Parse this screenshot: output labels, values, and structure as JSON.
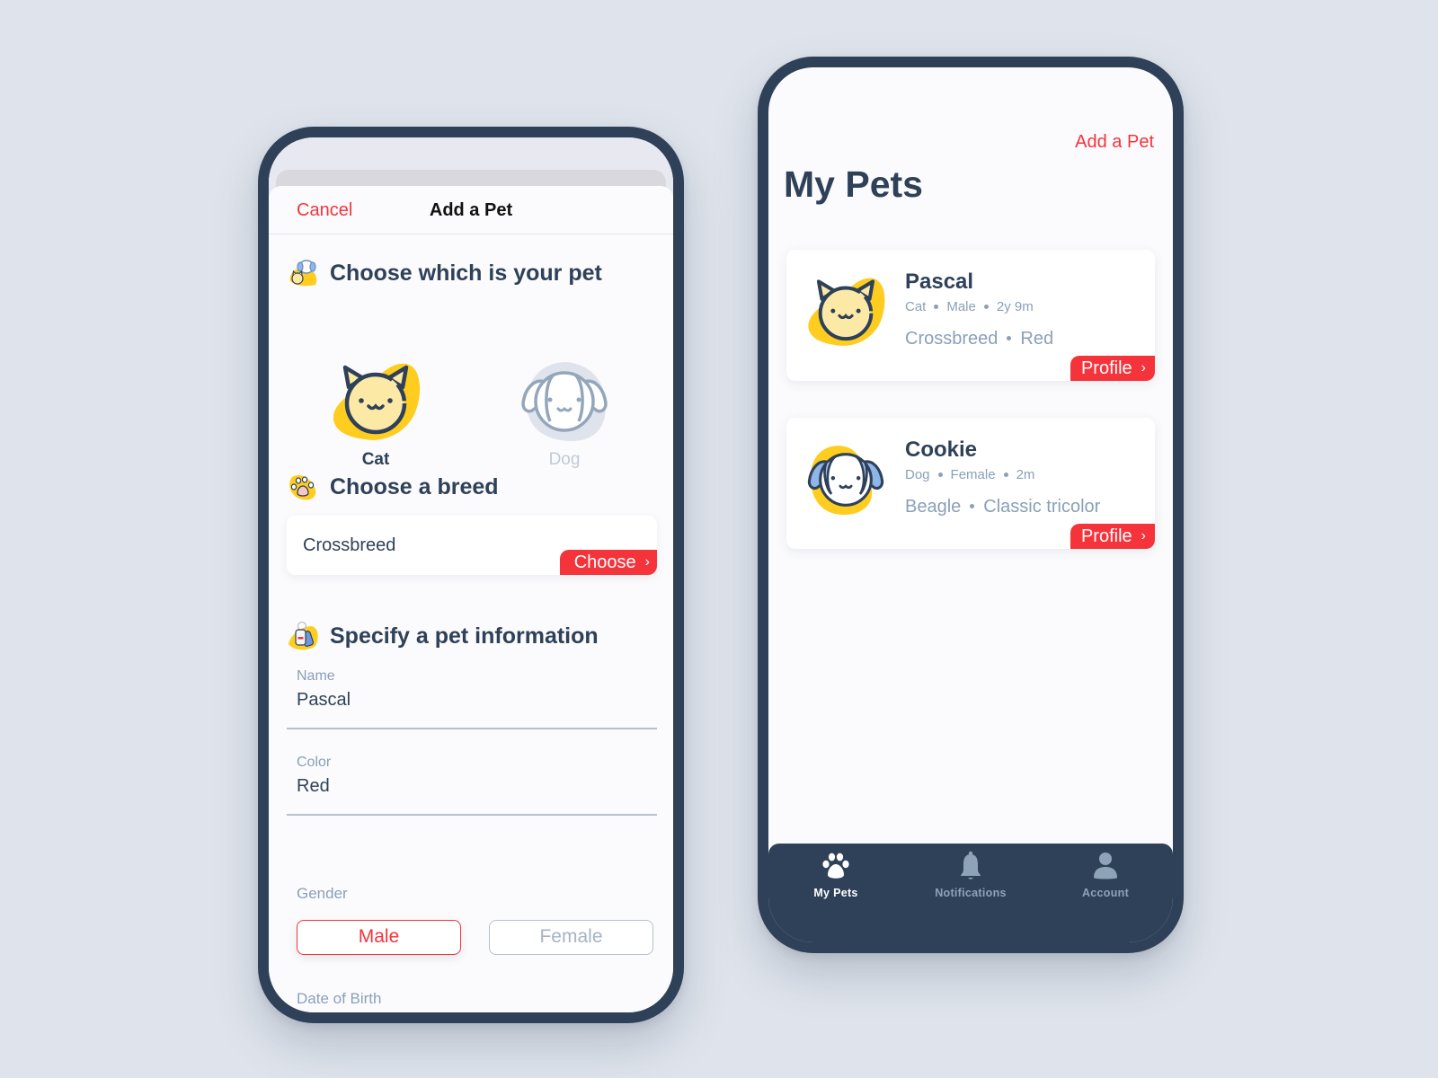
{
  "colors": {
    "background": "#dfe4ec",
    "phone_frame": "#2e4158",
    "accent_red": "#f5333a",
    "accent_yellow": "#ffcd1f",
    "text_primary": "#2e4158",
    "text_secondary": "#8aa0b8"
  },
  "add_pet_screen": {
    "navbar": {
      "cancel_label": "Cancel",
      "title": "Add a Pet"
    },
    "pet_type_section": {
      "title": "Choose which is your pet",
      "icon": "cat-dog-icon",
      "options": [
        {
          "label": "Cat",
          "icon": "cat-face-icon",
          "selected": true
        },
        {
          "label": "Dog",
          "icon": "dog-face-icon",
          "selected": false
        }
      ]
    },
    "breed_section": {
      "title": "Choose a breed",
      "icon": "paw-icon",
      "value": "Crossbreed",
      "button_label": "Choose",
      "button_icon": "chevron-right-icon"
    },
    "info_section": {
      "title": "Specify a pet information",
      "icon": "pet-tag-icon",
      "fields": [
        {
          "label": "Name",
          "value": "Pascal"
        },
        {
          "label": "Color",
          "value": "Red"
        }
      ],
      "gender": {
        "label": "Gender",
        "options": [
          {
            "label": "Male",
            "selected": true
          },
          {
            "label": "Female",
            "selected": false
          }
        ]
      },
      "date_of_birth": {
        "label": "Date of Birth",
        "value": ""
      }
    }
  },
  "my_pets_screen": {
    "add_link": "Add a Pet",
    "title": "My Pets",
    "pets": [
      {
        "name": "Pascal",
        "type": "Cat",
        "gender": "Male",
        "age": "2y 9m",
        "breed": "Crossbreed",
        "color": "Red",
        "avatar": "cat-face-icon",
        "button_label": "Profile"
      },
      {
        "name": "Cookie",
        "type": "Dog",
        "gender": "Female",
        "age": "2m",
        "breed": "Beagle",
        "color": "Classic tricolor",
        "avatar": "dog-face-icon",
        "button_label": "Profile"
      }
    ],
    "tabbar": [
      {
        "label": "My Pets",
        "icon": "paw-icon",
        "active": true
      },
      {
        "label": "Notifications",
        "icon": "bell-icon",
        "active": false
      },
      {
        "label": "Account",
        "icon": "user-icon",
        "active": false
      }
    ]
  }
}
